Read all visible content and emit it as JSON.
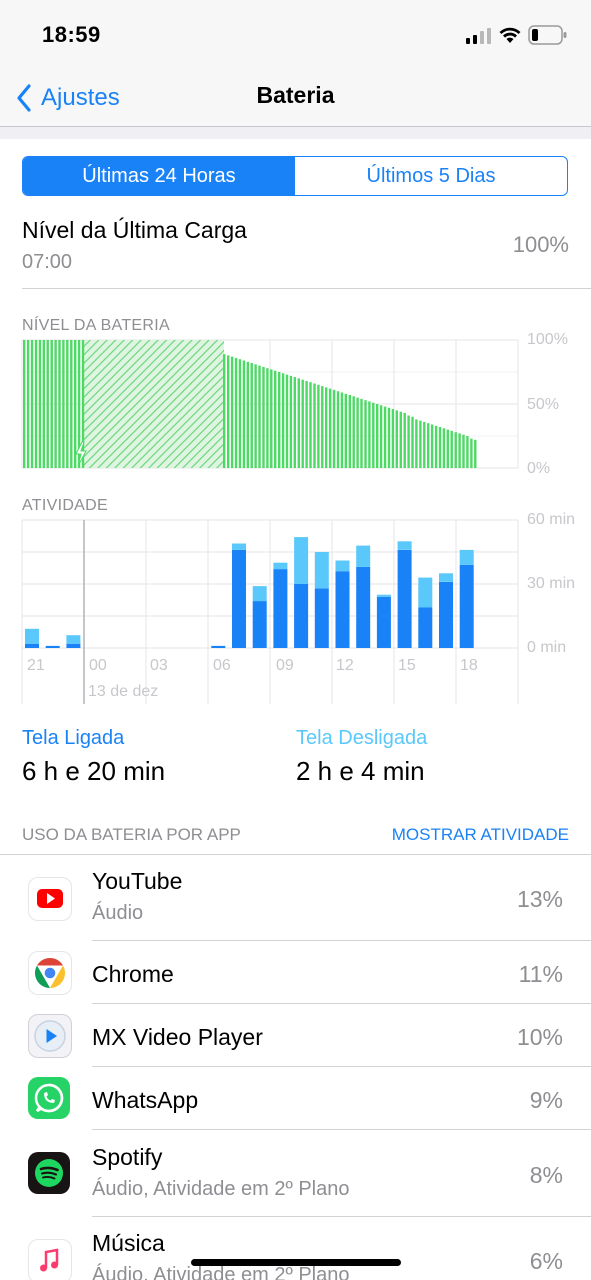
{
  "status_bar": {
    "time": "18:59"
  },
  "nav": {
    "back_label": "Ajustes",
    "title": "Bateria"
  },
  "segments": [
    "Últimas 24 Horas",
    "Últimos 5 Dias"
  ],
  "last_charge": {
    "label": "Nível da Última Carga",
    "time": "07:00",
    "value": "100%"
  },
  "battery_chart": {
    "label": "NÍVEL DA BATERIA",
    "y_labels": [
      "100%",
      "50%",
      "0%"
    ]
  },
  "activity_chart": {
    "label": "ATIVIDADE",
    "y_labels": [
      "60 min",
      "30 min",
      "0 min"
    ],
    "x_labels": [
      "21",
      "00",
      "03",
      "06",
      "09",
      "12",
      "15",
      "18"
    ],
    "date_label": "13 de dez"
  },
  "chart_data": [
    {
      "type": "bar",
      "title": "NÍVEL DA BATERIA",
      "ylim": [
        0,
        100
      ],
      "y_ticks": [
        "100%",
        "50%",
        "0%"
      ],
      "charging_segments": [
        [
          0,
          5
        ],
        [
          5,
          17
        ]
      ],
      "values": [
        100,
        100,
        100,
        100,
        100,
        100,
        100,
        100,
        100,
        100,
        100,
        100,
        100,
        100,
        100,
        100,
        100,
        100,
        100,
        100,
        100,
        100,
        100,
        100,
        100,
        100,
        100,
        100,
        100,
        100,
        100,
        100,
        100,
        100,
        100,
        100,
        100,
        100,
        100,
        100,
        99,
        98,
        97,
        96,
        96,
        95,
        94,
        93,
        92,
        91,
        90,
        89,
        88,
        87,
        86,
        85,
        84,
        83,
        82,
        81,
        80,
        79,
        78,
        77,
        76,
        75,
        74,
        73,
        72,
        71,
        70,
        69,
        68,
        67,
        66,
        65,
        64,
        63,
        62,
        61,
        60,
        59,
        58,
        57,
        56,
        55,
        54,
        53,
        52,
        51,
        50,
        49,
        48,
        47,
        46,
        45,
        44,
        43,
        41,
        40,
        38,
        37,
        36,
        35,
        34,
        33,
        32,
        31,
        30,
        29,
        28,
        27,
        26,
        25,
        23,
        22
      ],
      "note": ""
    },
    {
      "type": "bar",
      "title": "ATIVIDADE",
      "ylim": [
        0,
        60
      ],
      "y_ticks": [
        "60 min",
        "30 min",
        "0 min"
      ],
      "categories": [
        "21",
        "22",
        "23",
        "00",
        "01",
        "02",
        "03",
        "04",
        "05",
        "06",
        "07",
        "08",
        "09",
        "10",
        "11",
        "12",
        "13",
        "14",
        "15",
        "16",
        "17",
        "18"
      ],
      "series": [
        {
          "name": "Tela Ligada",
          "values": [
            2,
            1,
            2,
            0,
            0,
            0,
            0,
            0,
            0,
            1,
            46,
            22,
            37,
            30,
            28,
            36,
            38,
            24,
            46,
            19,
            31,
            39
          ]
        },
        {
          "name": "Tela Desligada",
          "values": [
            7,
            0,
            4,
            0,
            0,
            0,
            0,
            0,
            0,
            0,
            3,
            7,
            3,
            22,
            17,
            5,
            10,
            1,
            4,
            14,
            4,
            7
          ]
        }
      ]
    }
  ],
  "screen_time": {
    "on_label": "Tela Ligada",
    "on_value": "6 h e 20 min",
    "off_label": "Tela Desligada",
    "off_value": "2 h e 4 min"
  },
  "usage": {
    "header": "USO DA BATERIA POR APP",
    "link": "MOSTRAR ATIVIDADE",
    "apps": [
      {
        "name": "YouTube",
        "sub": "Áudio",
        "pct": "13%",
        "icon": "youtube-icon"
      },
      {
        "name": "Chrome",
        "sub": "",
        "pct": "11%",
        "icon": "chrome-icon"
      },
      {
        "name": "MX Video Player",
        "sub": "",
        "pct": "10%",
        "icon": "play-icon"
      },
      {
        "name": "WhatsApp",
        "sub": "",
        "pct": "9%",
        "icon": "whatsapp-icon"
      },
      {
        "name": "Spotify",
        "sub": "Áudio, Atividade em 2º Plano",
        "pct": "8%",
        "icon": "spotify-icon"
      },
      {
        "name": "Música",
        "sub": "Áudio, Atividade em 2º Plano",
        "pct": "6%",
        "icon": "music-icon"
      }
    ]
  },
  "colors": {
    "accent": "#1a82f7",
    "battery_green": "#4cd964",
    "screen_on": "#1a82f7",
    "screen_off": "#5ac8fa"
  }
}
